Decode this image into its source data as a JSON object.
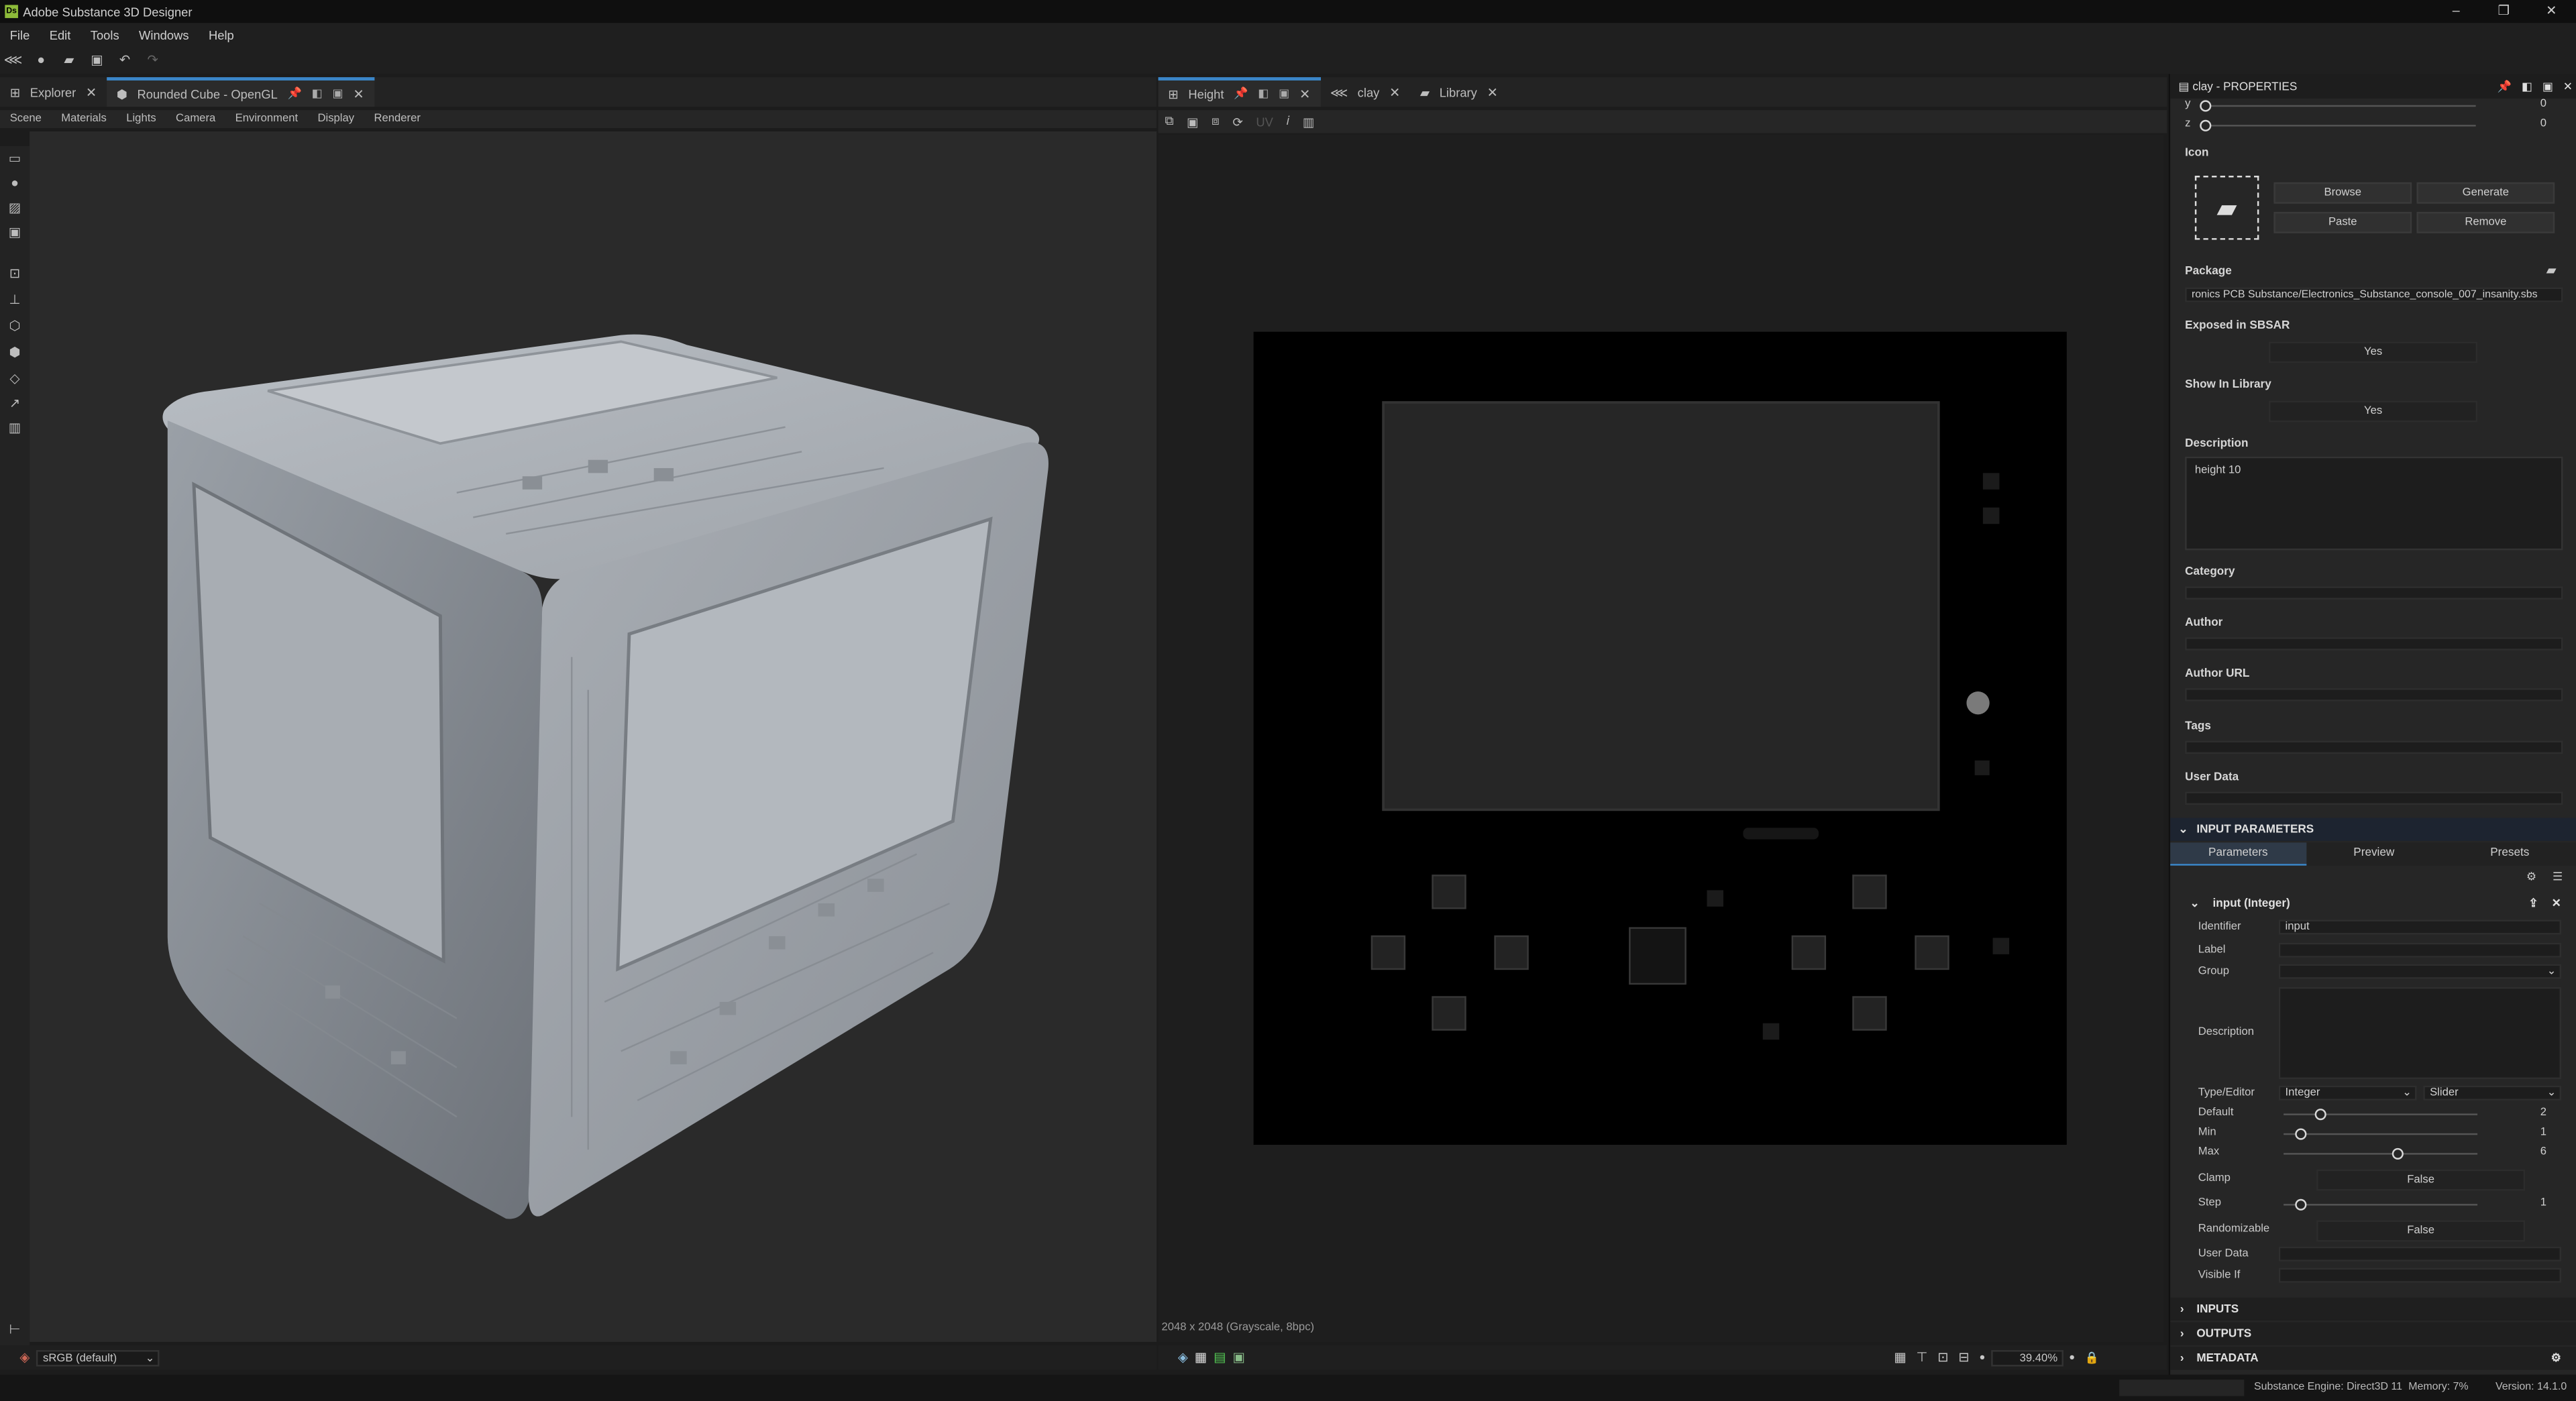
{
  "app": {
    "title": "Adobe Substance 3D Designer",
    "logo": "Ds"
  },
  "window_controls": {
    "minimize": "–",
    "restore": "❐",
    "close": "✕"
  },
  "menu": [
    "File",
    "Edit",
    "Tools",
    "Windows",
    "Help"
  ],
  "left_panel": {
    "tabs": [
      {
        "label": "Explorer"
      },
      {
        "label": "Rounded Cube - OpenGL"
      }
    ],
    "subtabs": [
      "Scene",
      "Materials",
      "Lights",
      "Camera",
      "Environment",
      "Display",
      "Renderer"
    ],
    "colorspace": "sRGB (default)"
  },
  "mid_panel": {
    "tabs": [
      {
        "label": "Height"
      },
      {
        "label": "clay"
      },
      {
        "label": "Library"
      }
    ],
    "toolbar_uv": "UV",
    "image_info": "2048 x 2048 (Grayscale, 8bpc)",
    "zoom": "39.40%"
  },
  "properties": {
    "title": "clay - PROPERTIES",
    "y_label": "y",
    "y_value": "0",
    "z_label": "z",
    "z_value": "0",
    "icon_label": "Icon",
    "icon_buttons": {
      "browse": "Browse",
      "generate": "Generate",
      "paste": "Paste",
      "remove": "Remove"
    },
    "package_label": "Package",
    "package_value": "ronics PCB Substance/Electronics_Substance_console_007_insanity.sbs",
    "exposed_label": "Exposed in SBSAR",
    "exposed_value": "Yes",
    "showlib_label": "Show In Library",
    "showlib_value": "Yes",
    "description_label": "Description",
    "description_value": "height 10",
    "category_label": "Category",
    "author_label": "Author",
    "author_url_label": "Author URL",
    "tags_label": "Tags",
    "user_data_label": "User Data",
    "input_params_header": "INPUT PARAMETERS",
    "param_tabs": [
      "Parameters",
      "Preview",
      "Presets"
    ],
    "param_title": "input (Integer)",
    "identifier_label": "Identifier",
    "identifier_value": "input",
    "label_label": "Label",
    "group_label": "Group",
    "pdesc_label": "Description",
    "type_label": "Type/Editor",
    "type_value": "Integer",
    "editor_value": "Slider",
    "default_label": "Default",
    "default_value": "2",
    "min_label": "Min",
    "min_value": "1",
    "max_label": "Max",
    "max_value": "6",
    "clamp_label": "Clamp",
    "clamp_value": "False",
    "step_label": "Step",
    "step_value": "1",
    "random_label": "Randomizable",
    "random_value": "False",
    "puserdata_label": "User Data",
    "visible_label": "Visible If",
    "inputs_header": "INPUTS",
    "outputs_header": "OUTPUTS",
    "metadata_header": "METADATA"
  },
  "status": {
    "engine": "Substance Engine: Direct3D 11",
    "memory": "Memory: 7%",
    "version": "Version: 14.1.0"
  }
}
